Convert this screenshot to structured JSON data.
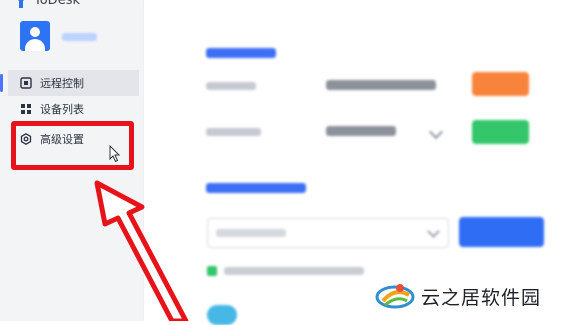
{
  "app": {
    "name": "ToDesk"
  },
  "sidebar": {
    "items": [
      {
        "label": "远程控制",
        "icon": "remote-control-icon"
      },
      {
        "label": "设备列表",
        "icon": "device-grid-icon"
      },
      {
        "label": "高级设置",
        "icon": "gear-icon"
      }
    ]
  },
  "watermark": {
    "text": "云之居软件园"
  },
  "colors": {
    "accent": "#2f6df5",
    "orange": "#f8843b",
    "green": "#34c66a",
    "highlight": "#e6131b"
  }
}
